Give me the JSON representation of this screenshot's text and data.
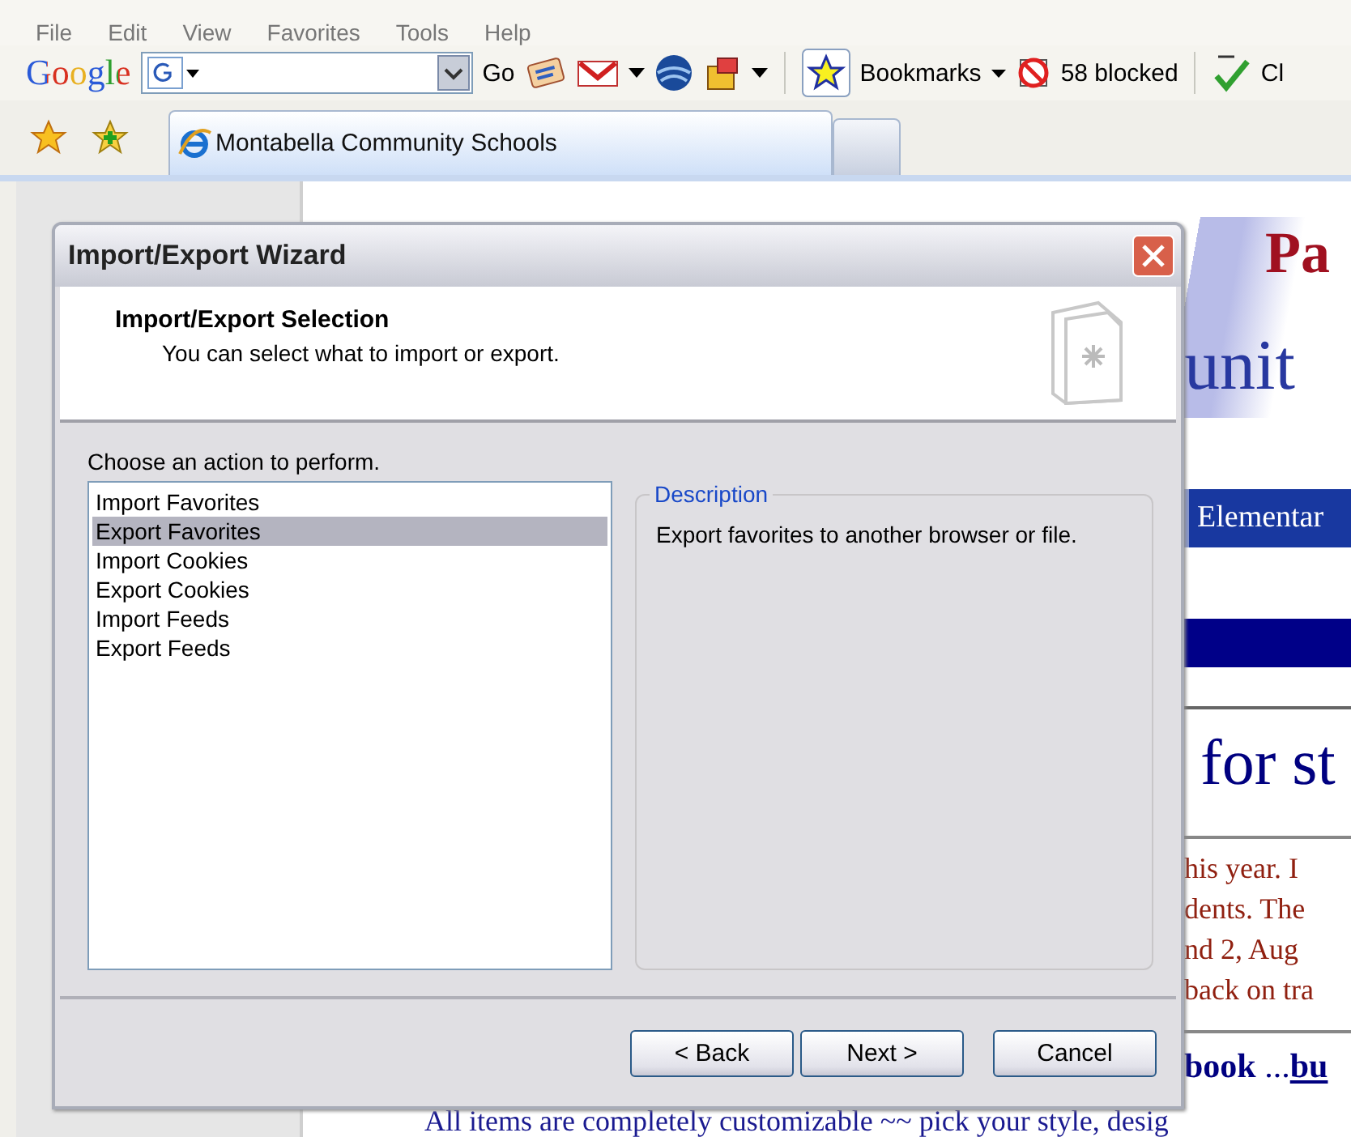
{
  "menu": [
    "File",
    "Edit",
    "View",
    "Favorites",
    "Tools",
    "Help"
  ],
  "google_toolbar": {
    "logo": "Google",
    "go": "Go",
    "bookmarks": "Bookmarks",
    "blocked": "58 blocked",
    "check": "Cl"
  },
  "tab": {
    "title": "Montabella Community Schools"
  },
  "page": {
    "banner_word": "Pa",
    "banner_subtitle": "unit",
    "nav_item": "Elementar",
    "heading": "for st",
    "paragraph": [
      "his year. I",
      "dents. The",
      "nd 2, Aug",
      "back on tra"
    ],
    "bold_line": "**book** ... ",
    "link": "bu",
    "bottom_line": "All items are completely customizable ~~ pick your style, desig"
  },
  "dialog": {
    "title": "Import/Export Wizard",
    "header_title": "Import/Export Selection",
    "header_subtitle": "You can select what to import or export.",
    "prompt": "Choose an action to perform.",
    "actions": [
      {
        "label": "Import Favorites",
        "selected": false
      },
      {
        "label": "Export Favorites",
        "selected": true
      },
      {
        "label": "Import Cookies",
        "selected": false
      },
      {
        "label": "Export Cookies",
        "selected": false
      },
      {
        "label": "Import Feeds",
        "selected": false
      },
      {
        "label": "Export Feeds",
        "selected": false
      }
    ],
    "description_label": "Description",
    "description": "Export favorites to another browser or file.",
    "buttons": [
      {
        "label": "< Back",
        "kind": "back"
      },
      {
        "label": "Next >",
        "kind": "next"
      },
      {
        "label": "Cancel",
        "kind": "cancel"
      }
    ]
  }
}
